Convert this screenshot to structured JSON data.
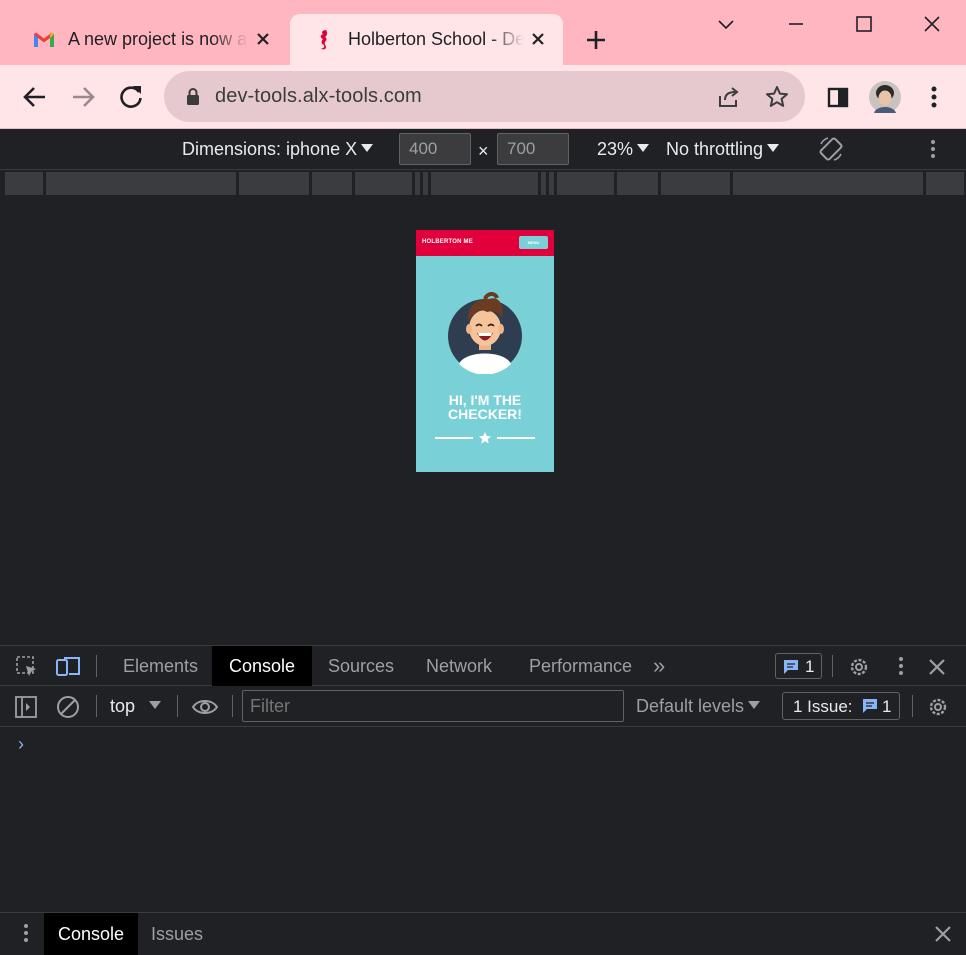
{
  "browser": {
    "tabs": [
      {
        "title": "A new project is now a",
        "favicon": "gmail-icon",
        "close": "✕"
      },
      {
        "title": "Holberton School - De",
        "favicon": "holberton-seahorse-icon",
        "close": "✕"
      }
    ],
    "new_tab": "+",
    "url": "dev-tools.alx-tools.com"
  },
  "device_toolbar": {
    "dimensions_label": "Dimensions: iphone X",
    "width": "400",
    "height": "700",
    "times": "×",
    "zoom": "23%",
    "throttling": "No throttling"
  },
  "preview": {
    "brand": "HOLBERTON ME",
    "menu": "MENU",
    "hero_line1": "HI, I'M THE",
    "hero_line2": "CHECKER!"
  },
  "devtools": {
    "tabs": [
      "Elements",
      "Console",
      "Sources",
      "Network",
      "Performance"
    ],
    "active_tab": "Console",
    "more_tabs": "»",
    "message_count": "1"
  },
  "console": {
    "context": "top",
    "filter_placeholder": "Filter",
    "levels": "Default levels",
    "issues_label": "1 Issue:",
    "issues_count": "1",
    "prompt": "›"
  },
  "drawer": {
    "tabs": [
      "Console",
      "Issues"
    ],
    "active_tab": "Console"
  },
  "colors": {
    "tabstrip_bg": "#ffb6c1",
    "toolbar_bg": "#ffe4e8",
    "devtools_bg": "#202124",
    "holberton_red": "#e1003c",
    "preview_teal": "#79d0d6",
    "link_blue": "#8ab4f8"
  }
}
